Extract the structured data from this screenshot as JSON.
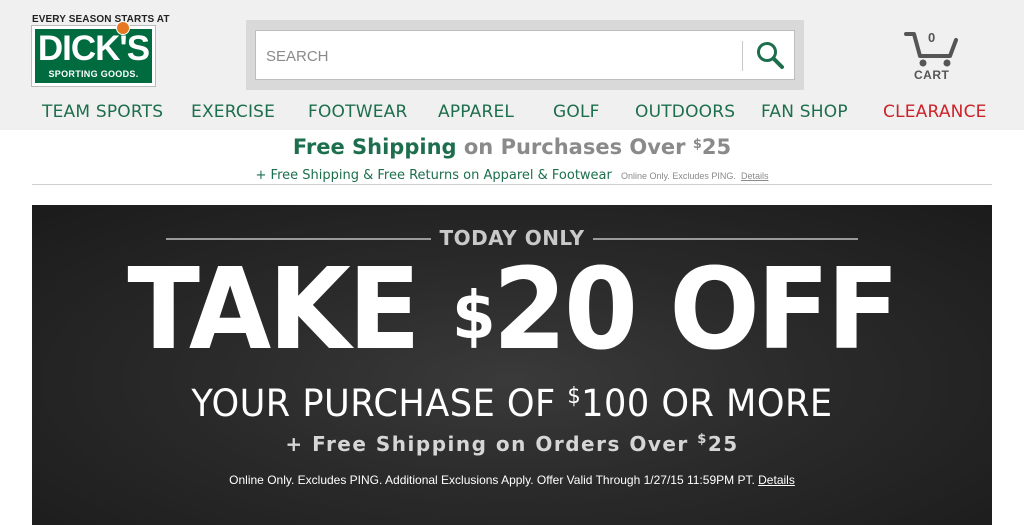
{
  "header": {
    "logo_tagline": "EVERY SEASON STARTS AT",
    "logo_main": "DICK'S",
    "logo_sub": "SPORTING GOODS.",
    "search_placeholder": "SEARCH",
    "cart_count": "0",
    "cart_label": "CART"
  },
  "nav": {
    "items": [
      "TEAM SPORTS",
      "EXERCISE",
      "FOOTWEAR",
      "APPAREL",
      "GOLF",
      "OUTDOORS",
      "FAN SHOP",
      "CLEARANCE"
    ]
  },
  "shipping": {
    "headline_green": "Free Shipping",
    "headline_gray": "on Purchases Over",
    "headline_dollar": "$",
    "headline_amount": "25",
    "subline": "+ Free Shipping & Free Returns on Apparel & Footwear",
    "note": "Online Only. Excludes PING.",
    "details_link": "Details"
  },
  "promo": {
    "eyebrow": "TODAY ONLY",
    "big_pre": "TAKE ",
    "big_dollar": "$",
    "big_amount": "20",
    "big_post": " OFF",
    "mid_pre": "YOUR PURCHASE OF ",
    "mid_dollar": "$",
    "mid_post": "100 OR MORE",
    "ship_pre": "+ Free Shipping on Orders Over ",
    "ship_dollar": "$",
    "ship_amount": "25",
    "fine_print": "Online Only. Excludes PING. Additional Exclusions Apply. Offer Valid Through 1/27/15 11:59PM PT.",
    "details_link": "Details"
  },
  "colors": {
    "brand_green": "#006b3f",
    "nav_green": "#1d6e4d",
    "clearance_red": "#cc2229",
    "banner_dark": "#2a2a2a"
  },
  "icons": {
    "search": "magnifier-icon",
    "cart": "shopping-cart-icon"
  }
}
